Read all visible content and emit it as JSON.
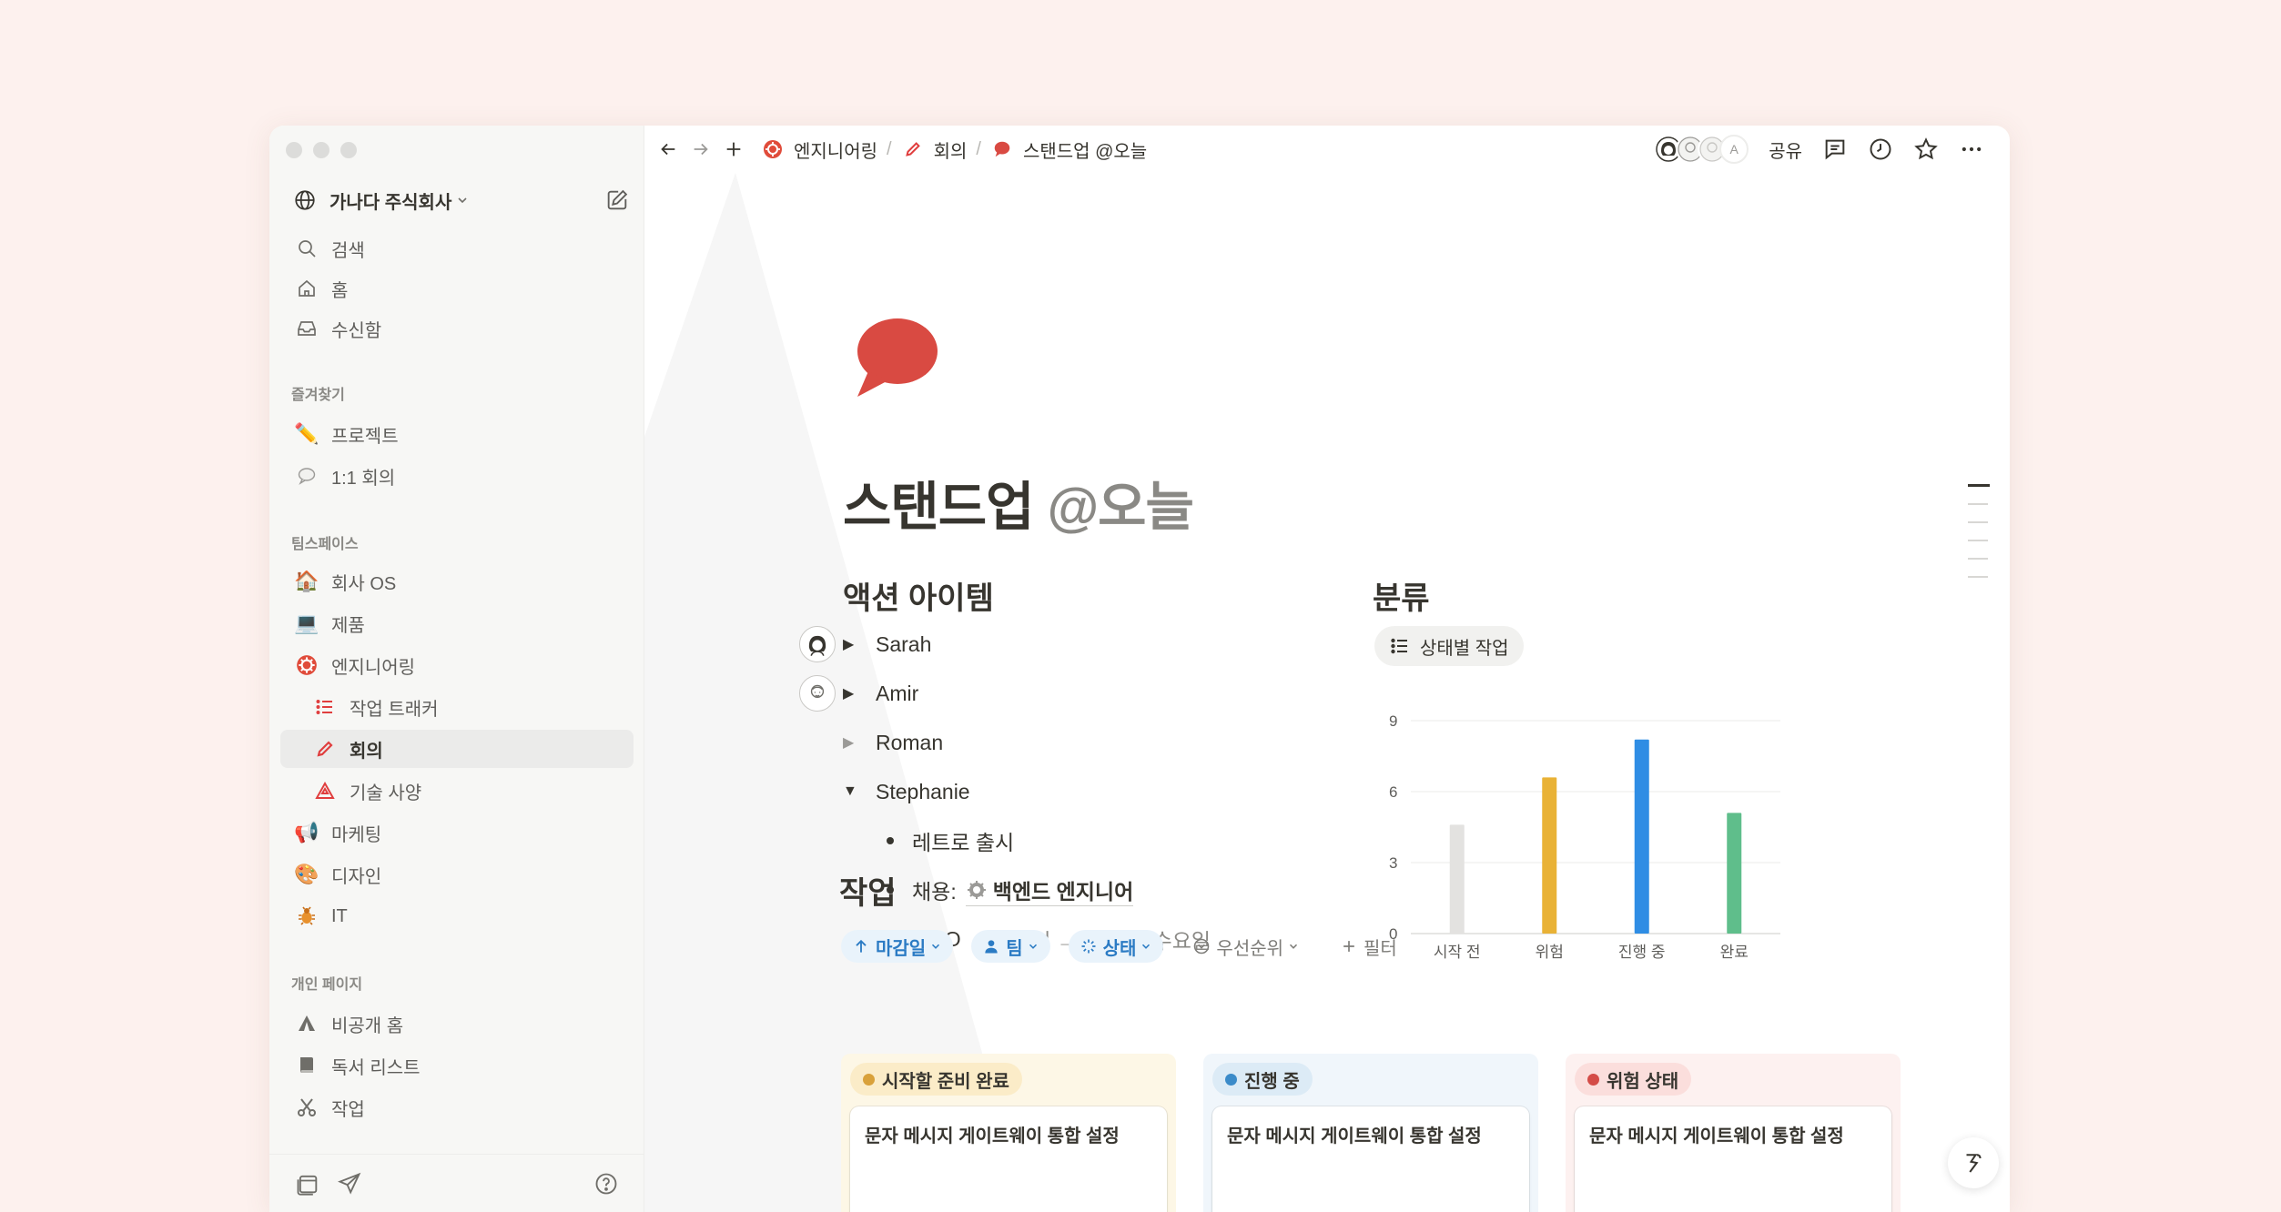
{
  "window_controls": [
    "close",
    "minimize",
    "maximize"
  ],
  "sidebar": {
    "workspace": {
      "name": "가나다 주식회사",
      "icon": "globe-icon"
    },
    "top_items": [
      {
        "label": "검색",
        "icon": "search-icon"
      },
      {
        "label": "홈",
        "icon": "home-icon"
      },
      {
        "label": "수신함",
        "icon": "inbox-icon"
      }
    ],
    "favorites_label": "즐겨찾기",
    "favorites": [
      {
        "label": "프로젝트",
        "icon": "pencil-emoji"
      },
      {
        "label": "1:1 회의",
        "icon": "speech-bubble-emoji"
      }
    ],
    "teamspace_label": "팀스페이스",
    "teamspace": [
      {
        "label": "회사 OS",
        "icon": "house-emoji"
      },
      {
        "label": "제품",
        "icon": "laptop-emoji"
      },
      {
        "label": "엔지니어링",
        "icon": "gear-emoji"
      },
      {
        "label": "작업 트래커",
        "icon": "list-icon",
        "sub": true
      },
      {
        "label": "회의",
        "icon": "pencil-icon",
        "sub": true,
        "active": true
      },
      {
        "label": "기술 사양",
        "icon": "triangle-icon",
        "sub": true
      },
      {
        "label": "마케팅",
        "icon": "megaphone-emoji"
      },
      {
        "label": "디자인",
        "icon": "palette-emoji"
      },
      {
        "label": "IT",
        "icon": "bug-emoji"
      }
    ],
    "private_label": "개인 페이지",
    "private": [
      {
        "label": "비공개 홈",
        "icon": "tent-icon"
      },
      {
        "label": "독서 리스트",
        "icon": "book-icon"
      },
      {
        "label": "작업",
        "icon": "scissors-icon"
      }
    ]
  },
  "topbar": {
    "breadcrumbs": [
      {
        "label": "엔지니어링",
        "icon": "gear-emoji"
      },
      {
        "label": "회의",
        "icon": "pencil-icon"
      },
      {
        "label": "스탠드업 @오늘",
        "icon": "speech-bubble-icon"
      }
    ],
    "avatar_initial": "A",
    "share_label": "공유"
  },
  "page": {
    "title": "스탠드업",
    "title_mention": "@오늘",
    "action_items_heading": "액션 아이템",
    "people": [
      {
        "name": "Sarah",
        "collapsed": true
      },
      {
        "name": "Amir",
        "collapsed": true
      },
      {
        "name": "Roman",
        "collapsed": true,
        "dim": true
      },
      {
        "name": "Stephanie",
        "collapsed": false
      }
    ],
    "bullets": [
      {
        "text": "레트로 출시"
      },
      {
        "prefix": "채용:",
        "link": "백엔드 엔지니어"
      },
      {
        "text": "OOO",
        "muted": "@금요일 → 다음 주 수요일"
      }
    ],
    "category_heading": "분류",
    "view_label": "상태별 작업",
    "tasks_heading": "작업",
    "filters": {
      "due": "마감일",
      "team": "팀",
      "status": "상태",
      "priority": "우선순위",
      "add_filter": "필터"
    },
    "board": [
      {
        "status": "시작할 준비 완료",
        "color": "#d9a13a",
        "bg": "#fdf7e6",
        "headbg": "#fbecc8",
        "card": "문자 메시지 게이트웨이 통합 설정"
      },
      {
        "status": "진행 중",
        "color": "#3b8bc9",
        "bg": "#f0f6fb",
        "headbg": "#dcebf6",
        "card": "문자 메시지 게이트웨이 통합 설정"
      },
      {
        "status": "위험 상태",
        "color": "#d44c47",
        "bg": "#fdf1f0",
        "headbg": "#fbdedc",
        "card": "문자 메시지 게이트웨이 통합 설정"
      }
    ]
  },
  "chart_data": {
    "type": "bar",
    "categories": [
      "시작 전",
      "위험",
      "진행 중",
      "완료"
    ],
    "values": [
      4.6,
      6.6,
      8.2,
      5.1
    ],
    "colors": [
      "#e3e2e0",
      "#e9b236",
      "#2f8de4",
      "#5fbe8b"
    ],
    "yticks": [
      0,
      3,
      6,
      9
    ],
    "ylim": [
      0,
      9
    ],
    "grid": true,
    "title": "",
    "xlabel": "",
    "ylabel": ""
  }
}
